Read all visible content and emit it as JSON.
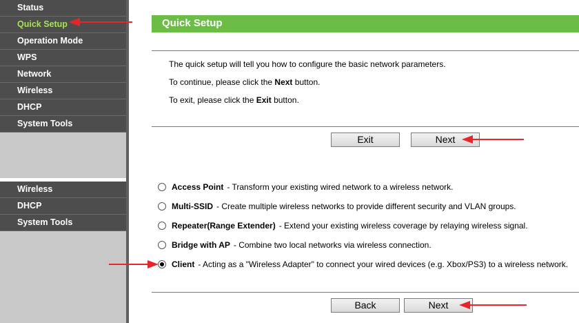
{
  "sidebar": {
    "group1": [
      "Status",
      "Quick Setup",
      "Operation Mode",
      "WPS",
      "Network",
      "Wireless",
      "DHCP",
      "System Tools"
    ],
    "group2": [
      "Wireless",
      "DHCP",
      "System Tools"
    ],
    "active_color": "#a8e05a"
  },
  "header": {
    "title": "Quick Setup"
  },
  "intro": {
    "line1": "The quick setup will tell you how to configure the basic network parameters.",
    "line2_prefix": "To continue, please click the ",
    "line2_bold": "Next",
    "line2_suffix": " button.",
    "line3_prefix": "To exit, please click the ",
    "line3_bold": "Exit",
    "line3_suffix": " button."
  },
  "buttons_top": {
    "exit": "Exit",
    "next": "Next"
  },
  "options": [
    {
      "name": "Access Point",
      "desc": "- Transform your existing wired network to a wireless network.",
      "checked": false
    },
    {
      "name": "Multi-SSID",
      "desc": "- Create multiple wireless networks to provide different security and VLAN groups.",
      "checked": false
    },
    {
      "name": "Repeater(Range Extender)",
      "desc": "- Extend your existing wireless coverage by relaying wireless signal.",
      "checked": false
    },
    {
      "name": "Bridge with AP",
      "desc": "- Combine two local networks via wireless connection.",
      "checked": false
    },
    {
      "name": "Client",
      "desc": "- Acting as a \"Wireless Adapter\" to connect your wired devices (e.g. Xbox/PS3) to a wireless network.",
      "checked": true
    }
  ],
  "buttons_bottom": {
    "back": "Back",
    "next": "Next"
  },
  "colors": {
    "header_green": "#6cbd45",
    "annotation_red": "#e8262a"
  }
}
